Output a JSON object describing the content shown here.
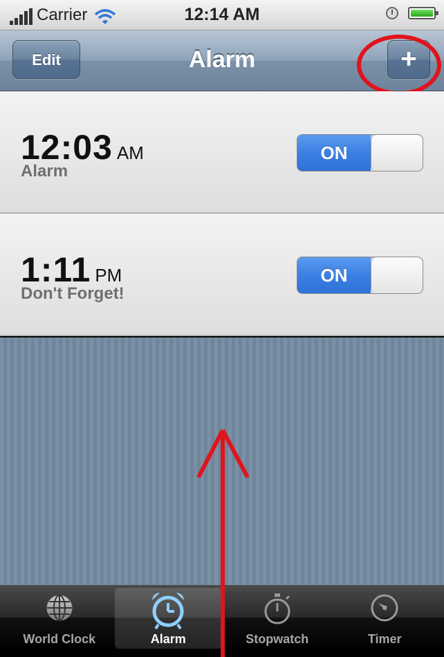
{
  "status_bar": {
    "carrier": "Carrier",
    "time": "12:14 AM",
    "icons": [
      "signal-bars-icon",
      "wifi-icon",
      "alarm-clock-indicator-icon",
      "battery-icon"
    ]
  },
  "nav": {
    "title": "Alarm",
    "edit_label": "Edit",
    "add_label": "+"
  },
  "alarms": [
    {
      "time": "12:03",
      "period": "AM",
      "label": "Alarm",
      "switch": "ON"
    },
    {
      "time": "1:11",
      "period": "PM",
      "label": "Don't Forget!",
      "switch": "ON"
    }
  ],
  "tabs": [
    {
      "label": "World Clock",
      "icon": "globe-icon",
      "selected": false
    },
    {
      "label": "Alarm",
      "icon": "alarm-clock-icon",
      "selected": true
    },
    {
      "label": "Stopwatch",
      "icon": "stopwatch-icon",
      "selected": false
    },
    {
      "label": "Timer",
      "icon": "timer-icon",
      "selected": false
    }
  ],
  "colors": {
    "nav_bar": "#8ea3b8",
    "switch_on": "#3c7fe2",
    "annotation_red": "#e0141c",
    "selected_tab_icon": "#8fd0ff"
  }
}
